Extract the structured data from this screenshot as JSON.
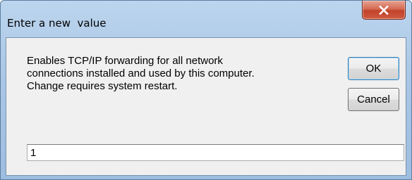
{
  "window": {
    "title": "Enter a new  value"
  },
  "dialog": {
    "description_lines": [
      "Enables TCP/IP forwarding for all network",
      "connections installed and used by this computer.",
      "Change requires system restart."
    ],
    "ok_label": "OK",
    "cancel_label": "Cancel",
    "input_value": "1"
  },
  "icons": {
    "close": "close-icon"
  },
  "colors": {
    "titlebar": "#a9c6e6",
    "close_button": "#c1432b",
    "client_background": "#f0f0f0",
    "default_button_border": "#3c7fb1"
  }
}
